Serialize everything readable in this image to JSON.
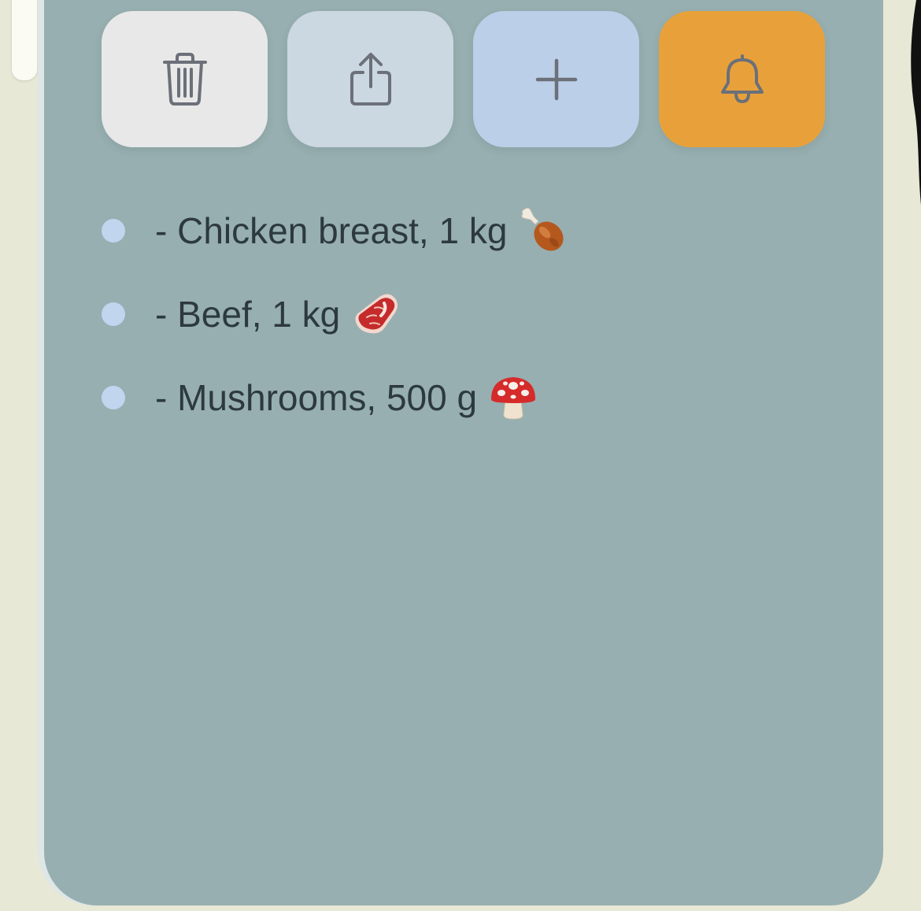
{
  "toolbar": {
    "buttons": [
      {
        "id": "delete",
        "icon": "trash-icon",
        "bg": "#e8e8e8"
      },
      {
        "id": "share",
        "icon": "share-icon",
        "bg": "#cbd7e1"
      },
      {
        "id": "add",
        "icon": "plus-icon",
        "bg": "#bccfe9"
      },
      {
        "id": "reminder",
        "icon": "bell-icon",
        "bg": "#e8a13a"
      }
    ]
  },
  "list": {
    "items": [
      {
        "text": "- Chicken breast, 1 kg",
        "emoji": "poultry-leg-icon"
      },
      {
        "text": "- Beef, 1 kg",
        "emoji": "cut-of-meat-icon"
      },
      {
        "text": "- Mushrooms, 500 g",
        "emoji": "mushroom-icon"
      }
    ]
  },
  "colors": {
    "page_bg": "#e7e8d5",
    "card_bg": "#97afb0",
    "text": "#2d3a3d",
    "bullet": "#c1d5ef",
    "icon_stroke": "#6b7079"
  }
}
